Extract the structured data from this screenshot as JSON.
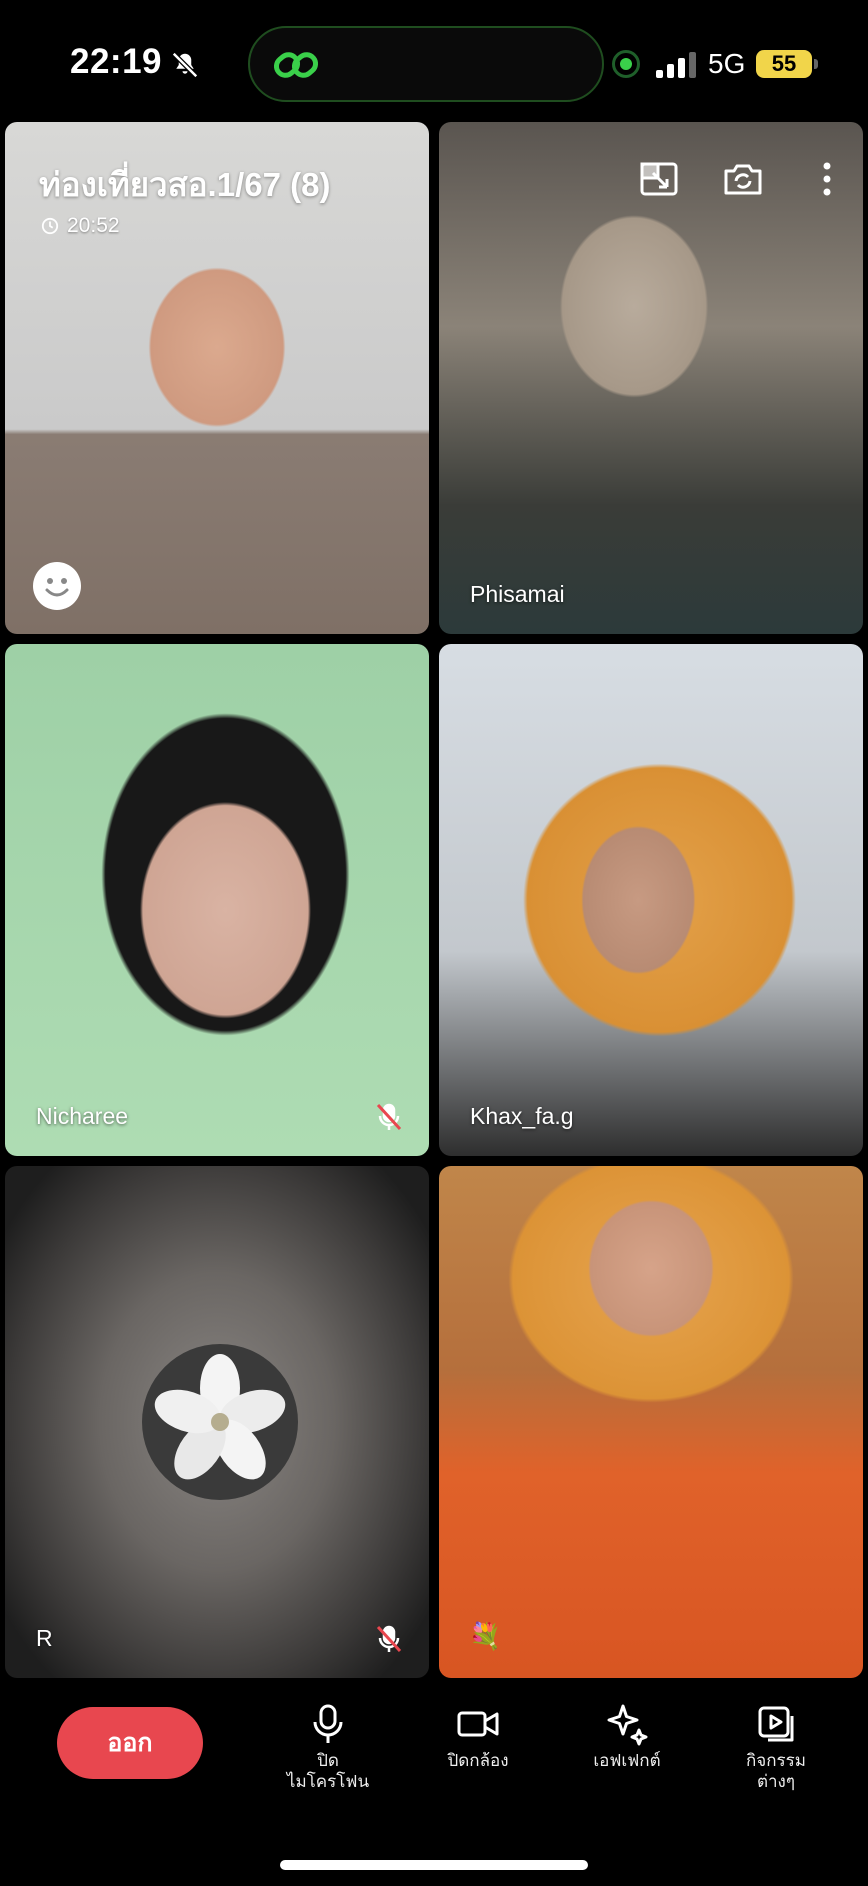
{
  "status_bar": {
    "time": "22:19",
    "network": "5G",
    "battery": "55"
  },
  "call": {
    "group_name": "ท่องเที่ยวสอ.1/67 (8)",
    "duration": "20:52"
  },
  "participants": [
    {
      "name": "",
      "muted": false
    },
    {
      "name": "Phisamai",
      "muted": false
    },
    {
      "name": "Nicharee",
      "muted": true
    },
    {
      "name": "Khax_fa.g",
      "muted": false
    },
    {
      "name": "R",
      "muted": true
    },
    {
      "name": "",
      "muted": false
    }
  ],
  "controls": {
    "leave": "ออก",
    "mic_line1": "ปิด",
    "mic_line2": "ไมโครโฟน",
    "camera": "ปิดกล้อง",
    "effects": "เอฟเฟกต์",
    "activities_line1": "กิจกรรม",
    "activities_line2": "ต่างๆ"
  },
  "colors": {
    "leave_button": "#e8474f",
    "battery": "#f1d54a",
    "island_accent": "#3ad04a"
  },
  "icons": [
    "bell-off-icon",
    "line-chain-icon",
    "pip-icon",
    "switch-camera-icon",
    "more-icon",
    "emoji-icon",
    "mic-off-icon",
    "flower-icon",
    "microphone-icon",
    "video-camera-icon",
    "sparkle-icon",
    "activities-icon"
  ]
}
